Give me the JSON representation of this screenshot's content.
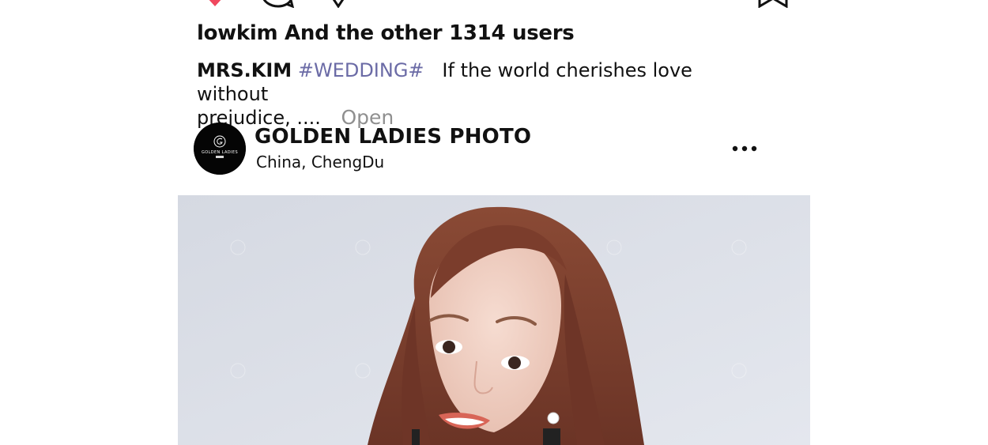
{
  "actions": {
    "like_icon": "heart-icon",
    "comment_icon": "comment-icon",
    "share_icon": "share-icon",
    "save_icon": "bookmark-icon",
    "like_color": "#f0485e"
  },
  "likes_text": "lowkim And the other 1314 users",
  "caption": {
    "author": "MRS.KIM",
    "hashtag": "#WEDDING#",
    "text_line1": "If the world cherishes love without",
    "text_line2": "prejudice, ....",
    "open_label": "Open"
  },
  "post": {
    "account_name": "GOLDEN LADIES PHOTO",
    "location": "China,  ChengDu",
    "avatar_logo_text": "GOLDEN LADIES",
    "more_icon": "more-dots-icon"
  },
  "photo": {
    "watermark_text": "GOLDEN LADIES"
  },
  "colors": {
    "hashtag": "#6b6ba6",
    "open_link": "#8f8f8f",
    "photo_background": "#d9dde5"
  }
}
